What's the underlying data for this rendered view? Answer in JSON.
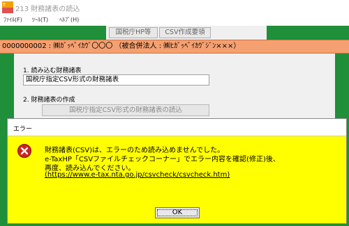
{
  "window": {
    "title": "213 財務諸表の読込",
    "icon_text": "e"
  },
  "menu": {
    "items": [
      "ﾌｧｲﾙ(F)",
      "ﾂｰﾙ(T)",
      "ﾍﾙﾌﾟ(H)"
    ]
  },
  "toolbar": {
    "buttons": [
      "国税庁HP等",
      "CSV作成要領"
    ]
  },
  "header": {
    "company": "0000000002 : ㈱ｶﾞｯﾍﾟｲｶｳﾞ〇〇〇 （被合併法人 : ㈱ﾋｶﾞｯﾍﾟｲｶｳﾞｼﾞﾝ×××）"
  },
  "main": {
    "section1_label": "1. 読み込む財務諸表",
    "section1_value": "国税庁指定CSV形式の財務諸表",
    "section2_label": "2. 財務諸表の作成",
    "read_button": "国税庁指定CSV形式の財務諸表の読込"
  },
  "dialog": {
    "title": "エラー",
    "icon": "error-icon",
    "lines": [
      "財務諸表(CSV)は、エラーのため読み込めませんでした。",
      "e-TaxHP「CSVファイルチェックコーナー」でエラー内容を確認(修正)後、",
      "再度、読み込んでください。",
      "(https://www.e-tax.nta.go.jp/csvcheck/csvcheck.htm)"
    ],
    "ok_label": "OK"
  },
  "colors": {
    "accent_green": "#1f8f3a",
    "header_orange": "#f4a070",
    "dialog_yellow": "#ffff00",
    "error_red": "#cc2222"
  }
}
